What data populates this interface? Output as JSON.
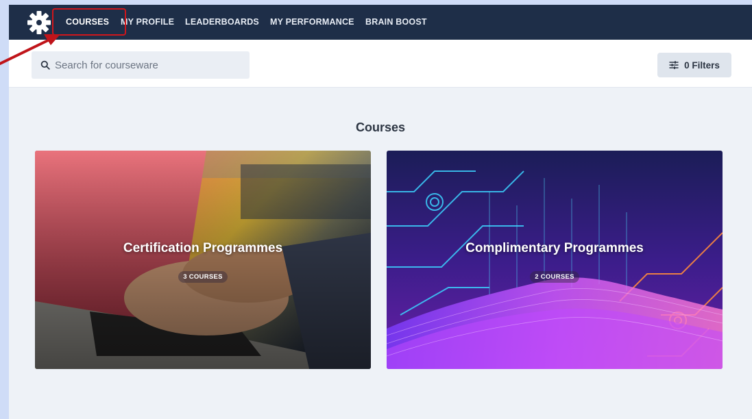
{
  "nav": {
    "items": [
      {
        "id": "courses",
        "label": "COURSES",
        "active": true
      },
      {
        "id": "my-profile",
        "label": "MY PROFILE",
        "active": false
      },
      {
        "id": "leaderboards",
        "label": "LEADERBOARDS",
        "active": false
      },
      {
        "id": "my-performance",
        "label": "MY PERFORMANCE",
        "active": false
      },
      {
        "id": "brain-boost",
        "label": "BRAIN BOOST",
        "active": false
      }
    ]
  },
  "search": {
    "icon": "search-icon",
    "placeholder": "Search for courseware",
    "value": ""
  },
  "filters": {
    "icon": "sliders-icon",
    "label": "0 Filters"
  },
  "main": {
    "section_title": "Courses",
    "cards": [
      {
        "title": "Certification Programmes",
        "count": "3 COURSES"
      },
      {
        "title": "Complimentary Programmes",
        "count": "2 COURSES"
      }
    ]
  },
  "colors": {
    "navbar": "#1e2e48",
    "highlight": "#d0161b",
    "page_bg": "#eef2f7"
  }
}
